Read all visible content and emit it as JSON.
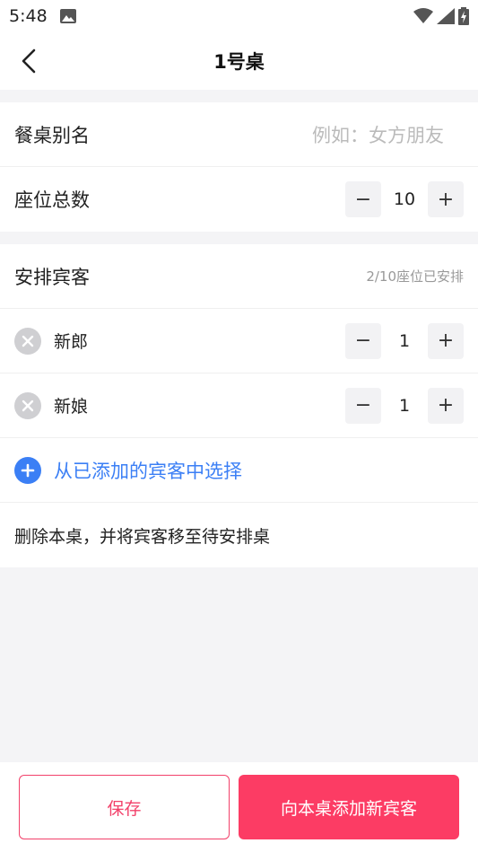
{
  "status_bar": {
    "time": "5:48"
  },
  "header": {
    "title": "1号桌"
  },
  "table_info": {
    "alias_label": "餐桌别名",
    "alias_placeholder": "例如：女方朋友",
    "seats_label": "座位总数",
    "seats_value": "10"
  },
  "guests": {
    "section_label": "安排宾客",
    "seats_hint": "2/10座位已安排",
    "items": [
      {
        "name": "新郎",
        "count": "1"
      },
      {
        "name": "新娘",
        "count": "1"
      }
    ],
    "add_from_existing": "从已添加的宾客中选择",
    "delete_table": "删除本桌，并将宾客移至待安排桌"
  },
  "stepper": {
    "minus": "−",
    "plus": "+"
  },
  "bottom": {
    "save_label": "保存",
    "add_guest_label": "向本桌添加新宾客"
  },
  "colors": {
    "accent_red": "#fc3c64",
    "accent_blue": "#3b7ff5"
  }
}
